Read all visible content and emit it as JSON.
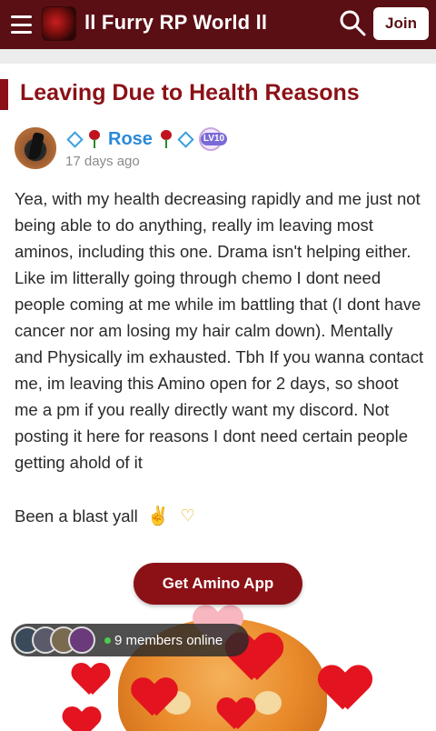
{
  "header": {
    "app_title": "ll Furry RP World ll",
    "join_label": "Join"
  },
  "post": {
    "title": "Leaving Due to Health Reasons",
    "author": {
      "name": "Rose",
      "level": "LV10",
      "timestamp": "17 days ago"
    },
    "body": "Yea, with my health decreasing rapidly and me just not being able to do anything, really im leaving most aminos, including this one. Drama isn't helping either. Like im litterally going through chemo I dont need people coming at me while im battling that (I dont have cancer nor am losing my hair calm down). Mentally and Physically im exhausted. Tbh If you wanna contact me, im leaving this Amino open for 2 days, so shoot me a pm if you really directly want my discord. Not posting it here for reasons I dont need certain people getting ahold of it",
    "farewell": "Been a blast yall"
  },
  "cta": {
    "get_app_label": "Get Amino App"
  },
  "online": {
    "text": "9 members online",
    "avatar_colors": [
      "#3a4a5a",
      "#5a5a6a",
      "#7a6a50",
      "#6a3a7a"
    ]
  },
  "colors": {
    "topbar": "#5a0f14",
    "accent": "#8b1116",
    "username": "#2a8ad8"
  }
}
